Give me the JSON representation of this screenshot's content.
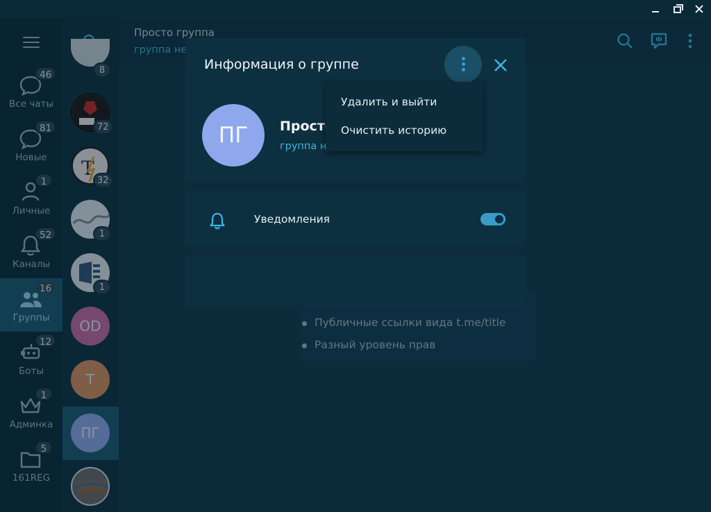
{
  "window": {
    "controls": [
      "minimize",
      "maximize",
      "close"
    ]
  },
  "folders": {
    "items": [
      {
        "label": "Все чаты",
        "badge": "46",
        "icon": "chat-bubble-icon"
      },
      {
        "label": "Новые",
        "badge": "81",
        "icon": "chat-bubble-icon"
      },
      {
        "label": "Личные",
        "badge": "1",
        "icon": "person-icon"
      },
      {
        "label": "Каналы",
        "badge": "52",
        "icon": "bell-icon"
      },
      {
        "label": "Группы",
        "badge": "16",
        "icon": "group-icon",
        "active": true
      },
      {
        "label": "Боты",
        "badge": "12",
        "icon": "bot-icon"
      },
      {
        "label": "Админка",
        "badge": "1",
        "icon": "crown-icon"
      },
      {
        "label": "161REG",
        "badge": "5",
        "icon": "folder-icon"
      }
    ]
  },
  "chats": [
    {
      "initials": "",
      "badge": "8",
      "color": "#c9d3da"
    },
    {
      "initials": "",
      "badge": "72",
      "color": "#e9e9e9"
    },
    {
      "initials": "",
      "badge": "32",
      "color": "#e9e9e9"
    },
    {
      "initials": "",
      "badge": "1",
      "color": "#dfe7ee"
    },
    {
      "initials": "",
      "badge": "1",
      "color": "#dfe7ee"
    },
    {
      "initials": "OD",
      "badge": "",
      "color": "#c86aa8"
    },
    {
      "initials": "T",
      "badge": "",
      "color": "#d79060"
    },
    {
      "initials": "ПГ",
      "badge": "",
      "color": "#8fa7ec",
      "active": true
    },
    {
      "initials": "",
      "badge": "",
      "color": "#6c6c6c"
    }
  ],
  "header": {
    "title": "Просто группа",
    "subtitle": "группа не"
  },
  "background_info": {
    "bullets": [
      "Публичные ссылки вида t.me/title",
      "Разный уровень прав"
    ]
  },
  "modal": {
    "title": "Информация о группе",
    "group": {
      "initials": "ПГ",
      "name": "Просто",
      "status": "группа н"
    },
    "notifications": {
      "label": "Уведомления",
      "enabled": true
    }
  },
  "menu": {
    "items": [
      "Удалить и выйти",
      "Очистить историю"
    ]
  },
  "colors": {
    "accent": "#3fb4e0",
    "active_folder": "#1d5a74",
    "group_avatar": "#8fa7ec"
  }
}
